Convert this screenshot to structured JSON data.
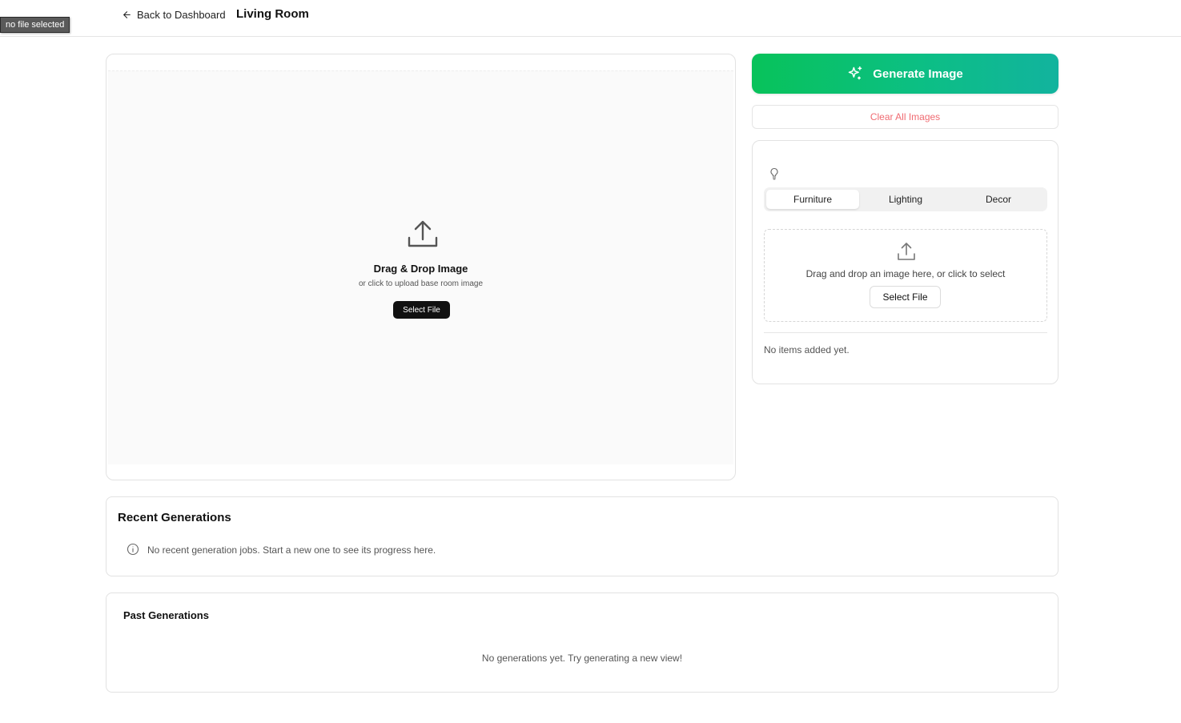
{
  "tooltip": {
    "text": "no file selected"
  },
  "header": {
    "back_label": "Back to Dashboard",
    "title": "Living Room"
  },
  "base_upload": {
    "title": "Drag & Drop Image",
    "subtitle": "or click to upload base room image",
    "button_label": "Select File",
    "icon": "upload-icon"
  },
  "actions": {
    "generate_label": "Generate Image",
    "generate_icon": "sparkles-icon",
    "clear_label": "Clear All Images"
  },
  "items_panel": {
    "icon": "lightbulb-icon",
    "tabs": [
      {
        "label": "Furniture",
        "active": true
      },
      {
        "label": "Lighting",
        "active": false
      },
      {
        "label": "Decor",
        "active": false
      }
    ],
    "dropzone_text": "Drag and drop an image here, or click to select",
    "dropzone_button": "Select File",
    "empty_text": "No items added yet."
  },
  "recent": {
    "title": "Recent Generations",
    "empty_text": "No recent generation jobs. Start a new one to see its progress here."
  },
  "past": {
    "title": "Past Generations",
    "empty_text": "No generations yet. Try generating a new view!"
  },
  "colors": {
    "gradient_start": "#08c25a",
    "gradient_end": "#12b39e",
    "danger_text": "#f06b72"
  }
}
